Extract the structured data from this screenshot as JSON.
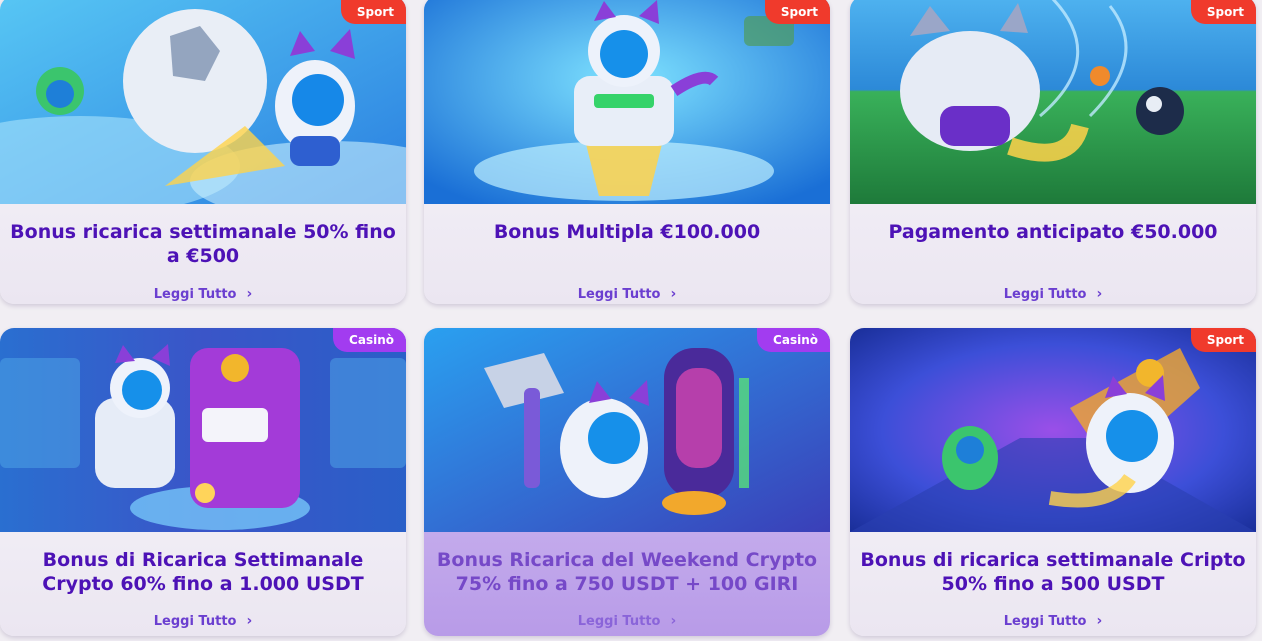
{
  "promotions": [
    {
      "badge": "Sport",
      "title": "Bonus ricarica settimanale 50% fino a €500",
      "read_more": "Leggi Tutto"
    },
    {
      "badge": "Sport",
      "title": "Bonus Multipla €100.000",
      "read_more": "Leggi Tutto"
    },
    {
      "badge": "Sport",
      "title": "Pagamento anticipato €50.000",
      "read_more": "Leggi Tutto"
    },
    {
      "badge": "Casinò",
      "title": "Bonus di Ricarica Settimanale Crypto 60% fino a 1.000 USDT",
      "read_more": "Leggi Tutto"
    },
    {
      "badge": "Casinò",
      "title": "Bonus Ricarica del Weekend Crypto 75% fino a 750 USDT + 100 GIRI",
      "read_more": "Leggi Tutto"
    },
    {
      "badge": "Sport",
      "title": "Bonus di ricarica settimanale Cripto 50% fino a 500 USDT",
      "read_more": "Leggi Tutto"
    }
  ],
  "chevron_icon": "chevron-right-icon",
  "colors": {
    "sport_badge": "#f03a2c",
    "casino_badge": "#a23cf0",
    "title": "#4d12b6",
    "link": "#6b3fd0"
  }
}
